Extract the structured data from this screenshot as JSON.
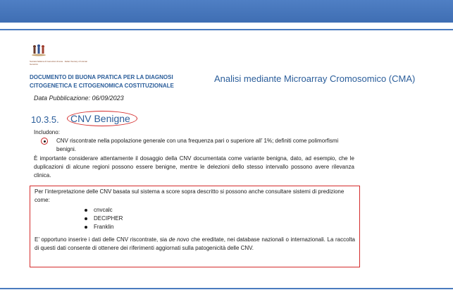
{
  "header": {
    "society_text": "Società Italiana di Genetica Umana · Italian Society of Human Genetics",
    "doc_title": "DOCUMENTO DI BUONA PRATICA PER LA DIAGNOSI CITOGENETICA E CITOGENOMICA COSTITUZIONALE",
    "doc_subtitle": "Analisi mediante Microarray Cromosomico (CMA)",
    "pub_date": "Data Pubblicazione: 06/09/2023"
  },
  "section": {
    "number": "10.3.5.",
    "title": "CNV Benigne",
    "include_label": "Includono:",
    "bullet_text": "CNV riscontrate nella popolazione generale con una frequenza pari o superiore all’ 1%; definiti come polimorfismi benigni.",
    "paragraph": "È importante considerare attentamente il dosaggio della CNV documentata come variante benigna, dato, ad esempio, che le duplicazioni di alcune regioni possono essere benigne, mentre le delezioni dello stesso intervallo possono avere rilevanza clinica."
  },
  "box": {
    "intro": "Per l’interpretazione delle CNV basata sul sistema a score sopra descritto si possono anche consultare sistemi di predizione come:",
    "tools": [
      "cnvcalc",
      "DECIPHER",
      "Franklin"
    ],
    "para_part1": "E’ opportuno inserire i dati delle CNV riscontrate, sia ",
    "para_italic": "de novo",
    "para_part2": " che ereditate, nei database nazionali o internazionali. La raccolta di questi dati consente di ottenere dei riferimenti aggiornati sulla patogenicità delle CNV."
  },
  "colors": {
    "accent_blue": "#2a5d9a",
    "annotation_red": "#d42a2a"
  }
}
